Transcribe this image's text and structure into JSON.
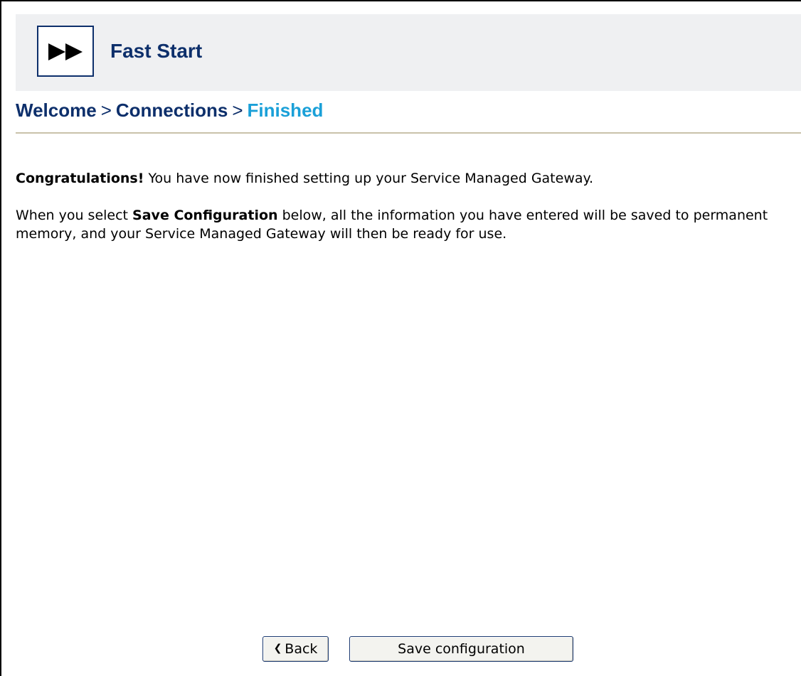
{
  "header": {
    "title": "Fast Start",
    "logo_icon": "fast-forward-icon",
    "colors": {
      "brand": "#0d2f6b",
      "band": "#eff0f2",
      "current_step": "#1aa0d8"
    }
  },
  "breadcrumb": {
    "steps": [
      {
        "label": "Welcome",
        "current": false
      },
      {
        "label": "Connections",
        "current": false
      },
      {
        "label": "Finished",
        "current": true
      }
    ],
    "separator": ">"
  },
  "content": {
    "congrats_bold": "Congratulations!",
    "congrats_text": " You have now finished setting up your Service Managed Gateway.",
    "info_prefix": "When you select ",
    "info_bold": "Save Configuration",
    "info_suffix": " below, all the information you have entered will be saved to permanent memory, and your Service Managed Gateway will then be ready for use."
  },
  "buttons": {
    "back_label": "Back",
    "back_icon": "chevron-left-icon",
    "save_label": "Save configuration"
  }
}
